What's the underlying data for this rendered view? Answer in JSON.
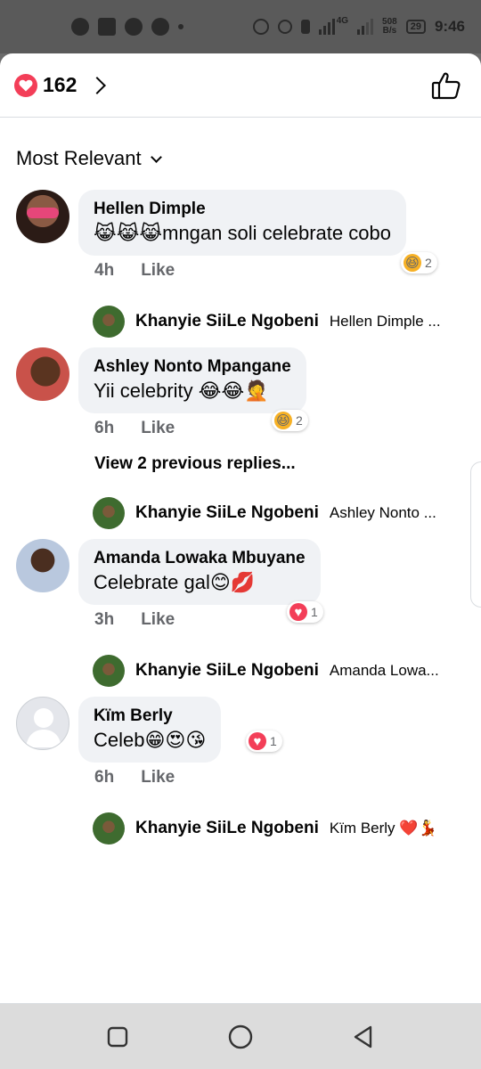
{
  "status_bar": {
    "time": "9:46",
    "speed_value": "508",
    "speed_unit": "B/s",
    "battery": "29",
    "network": "4G"
  },
  "header": {
    "reaction_count": "162"
  },
  "sort": {
    "label": "Most Relevant"
  },
  "comments": [
    {
      "name": "Hellen Dimple",
      "text": "😹😹😹mngan soli celebrate cobo",
      "time": "4h",
      "like_label": "Like",
      "reaction_emoji": "😆",
      "reaction_count": "2",
      "reply": {
        "name": "Khanyie SiiLe Ngobeni",
        "snippet": "Hellen Dimple ..."
      }
    },
    {
      "name": "Ashley Nonto Mpangane",
      "text": "Yii celebrity 😂😂🤦",
      "time": "6h",
      "like_label": "Like",
      "reaction_emoji": "😆",
      "reaction_count": "2",
      "view_previous": "View 2 previous replies...",
      "reply": {
        "name": "Khanyie SiiLe Ngobeni",
        "snippet": "Ashley Nonto ..."
      }
    },
    {
      "name": "Amanda Lowaka Mbuyane",
      "text": "Celebrate gal😊💋",
      "time": "3h",
      "like_label": "Like",
      "reaction_emoji": "♥",
      "reaction_count": "1",
      "reply": {
        "name": "Khanyie SiiLe Ngobeni",
        "snippet": "Amanda Lowa..."
      }
    },
    {
      "name": "Kïm Berly",
      "text": "Celeb😁😍😘",
      "time": "6h",
      "like_label": "Like",
      "reaction_emoji": "♥",
      "reaction_count": "1",
      "reply": {
        "name": "Khanyie SiiLe Ngobeni",
        "snippet": "Kïm Berly ❤️💃"
      }
    }
  ],
  "colors": {
    "love": "#f33e58",
    "haha": "#f7b125",
    "bubble": "#f0f2f5",
    "secondary_text": "#65676b"
  }
}
